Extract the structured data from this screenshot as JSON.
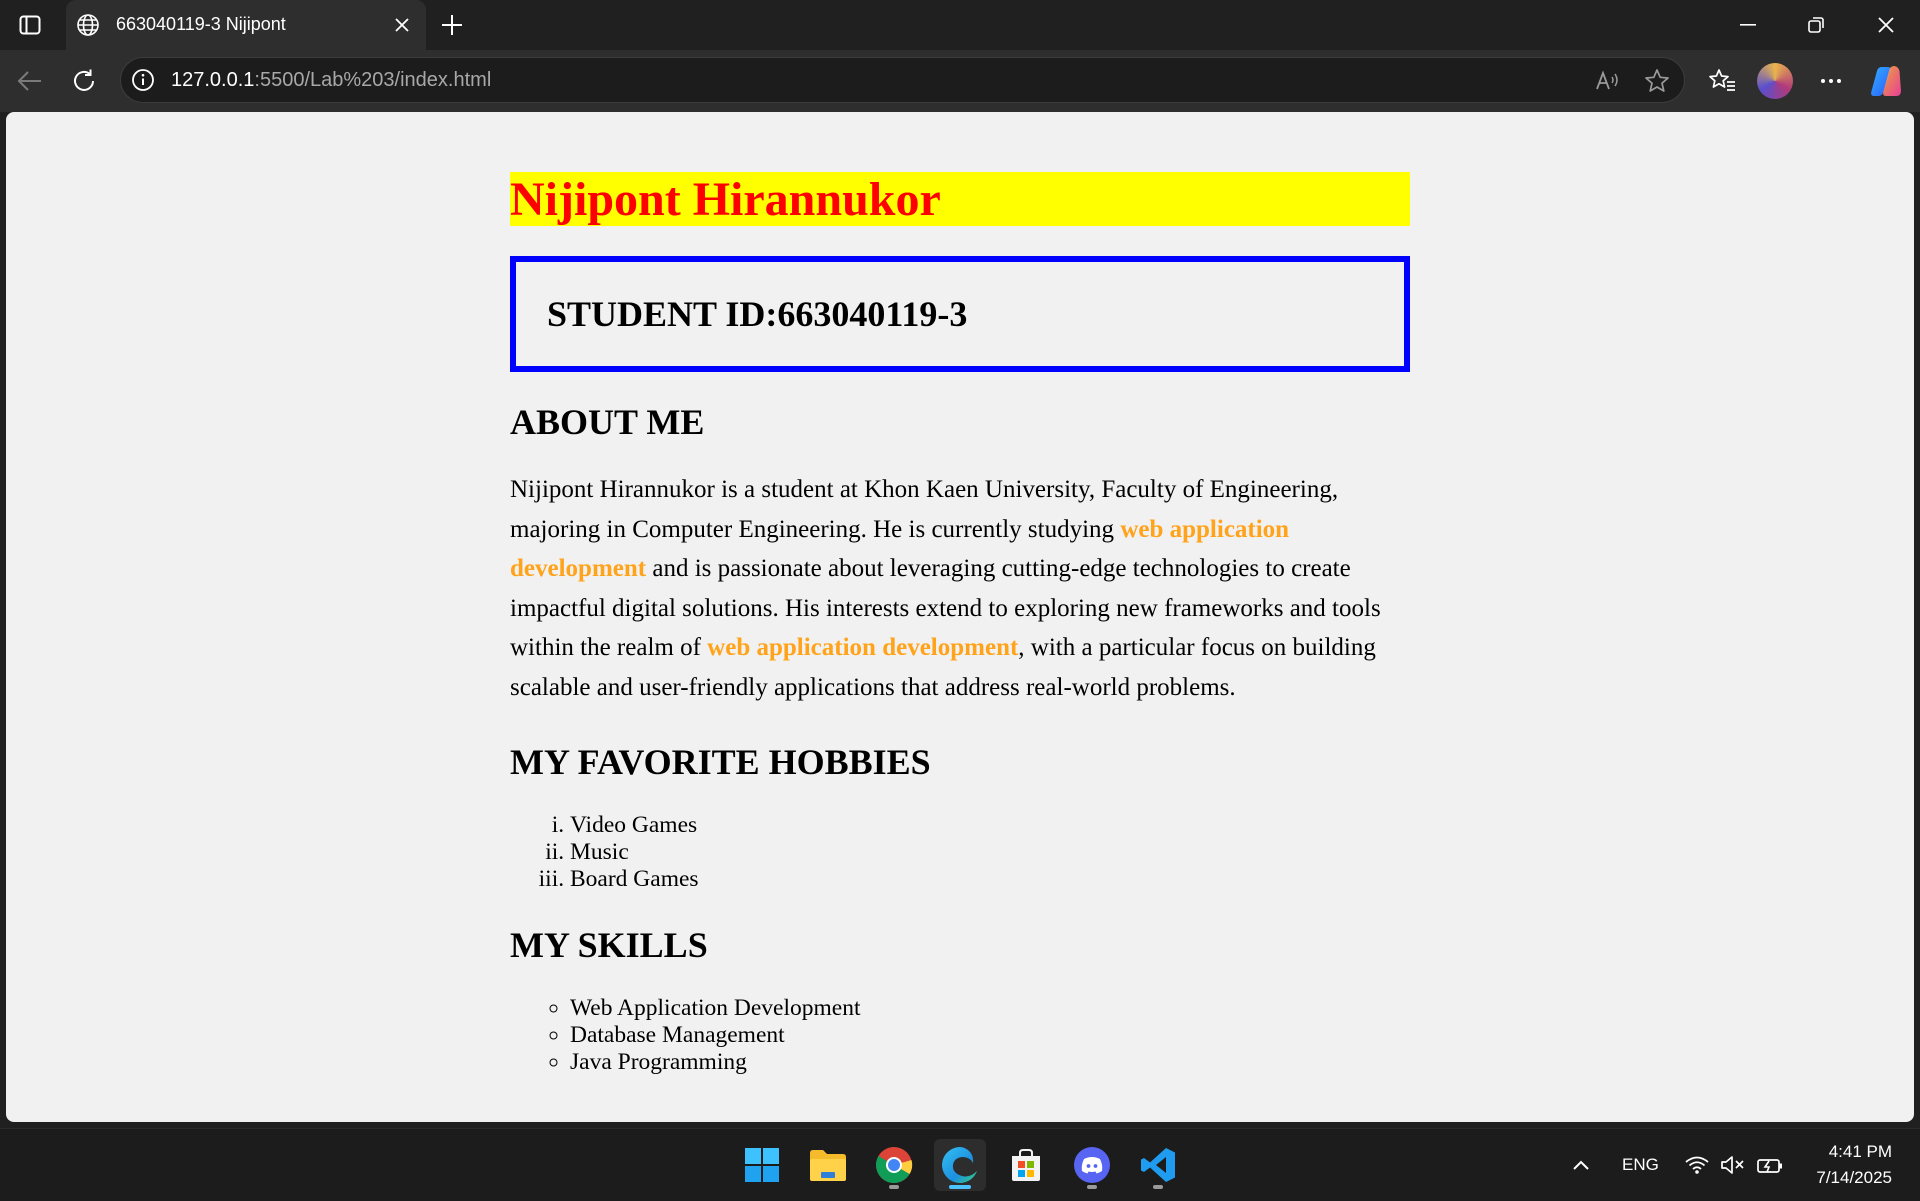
{
  "browser": {
    "tab_title": "663040119-3 Nijipont",
    "url_host": "127.0.0.1",
    "url_rest": ":5500/Lab%203/index.html"
  },
  "page": {
    "name": "Nijipont Hirannukor",
    "student_id": "STUDENT ID:663040119-3",
    "about_heading": "ABOUT ME",
    "about": {
      "t1": "Nijipont Hirannukor is a student at Khon Kaen University, Faculty of Engineering, majoring in Computer Engineering. He is currently studying ",
      "h1": "web application development",
      "t2": " and is passionate about leveraging cutting-edge technologies to create impactful digital solutions. His interests extend to exploring new frameworks and tools within the realm of ",
      "h2": "web application development",
      "t3": ", with a particular focus on building scalable and user-friendly applications that address real-world problems."
    },
    "hobbies_heading": "MY FAVORITE HOBBIES",
    "hobbies": [
      "Video Games",
      "Music",
      "Board Games"
    ],
    "skills_heading": "MY SKILLS",
    "skills": [
      "Web Application Development",
      "Database Management",
      "Java Programming"
    ],
    "colors": {
      "name_bg": "#ffff00",
      "name_fg": "#ff0000",
      "id_border": "#0000ff",
      "highlight": "#ffa31a"
    }
  },
  "taskbar": {
    "language": "ENG",
    "time": "4:41 PM",
    "date": "7/14/2025",
    "apps": [
      "start-icon",
      "file-explorer-icon",
      "chrome-icon",
      "edge-icon",
      "store-icon",
      "discord-icon",
      "vscode-icon"
    ]
  }
}
